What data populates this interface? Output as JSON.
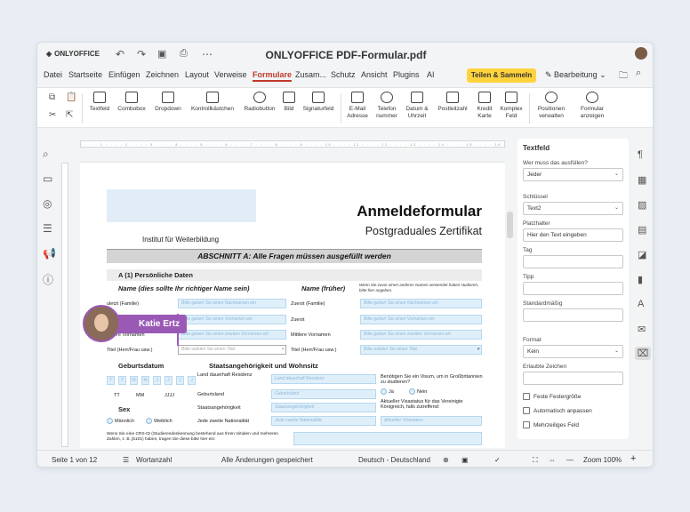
{
  "app": {
    "brand": "ONLYOFFICE",
    "doc_title": "ONLYOFFICE PDF-Formular.pdf"
  },
  "menu": [
    "Datei",
    "Startseite",
    "Einfügen",
    "Zeichnen",
    "Layout",
    "Verweise",
    "Formulare",
    "Zusam...",
    "Schutz",
    "Ansicht",
    "Plugins",
    "AI"
  ],
  "menu_active": "Formulare",
  "share_label": "Teilen & Sammeln",
  "edit_mode": "Bearbeitung",
  "toolbar": [
    {
      "label": "Textfeld",
      "icon": "textfield-icon"
    },
    {
      "label": "Combobox",
      "icon": "combobox-icon"
    },
    {
      "label": "Dropdown",
      "icon": "dropdown-icon"
    },
    {
      "label": "Kontrollkästchen",
      "icon": "checkbox-icon"
    },
    {
      "label": "Radiobutton",
      "icon": "radiobutton-icon"
    },
    {
      "label": "Bild",
      "icon": "image-icon"
    },
    {
      "label": "Signaturfeld",
      "icon": "signature-icon"
    },
    {
      "label": "E-Mail\nAdresse",
      "icon": "email-icon"
    },
    {
      "label": "Telefon\nnummer",
      "icon": "phone-icon"
    },
    {
      "label": "Datum &\nUhrzeit",
      "icon": "calendar-icon"
    },
    {
      "label": "Postleitzahl",
      "icon": "zip-icon"
    },
    {
      "label": "Kredit\nKarte",
      "icon": "creditcard-icon"
    },
    {
      "label": "Komplex\nFeld",
      "icon": "complex-icon"
    },
    {
      "label": "Positionen\nverwalten",
      "icon": "users-icon"
    },
    {
      "label": "Formular\nanzeigen",
      "icon": "eye-icon"
    }
  ],
  "page": {
    "title": "Anmeldeformular",
    "subtitle": "Postgraduales Zertifikat",
    "institute": "Institut für Weiterbildung",
    "section_a": "ABSCHNITT A: Alle Fragen müssen ausgefüllt werden",
    "personal": "A (1) Persönliche Daten",
    "name_hdr": "Name (dies sollte Ihr richtiger Name sein)",
    "name_prev_hdr": "Name (früher)",
    "name_prev_note": "Wenn Sie zuvor einen anderen Namen verwendet haben studieren, bitte hier angeben.",
    "row_first": "Zuerst (Familie)",
    "row_first2": "Zuerst",
    "row_middle": "Mittlere Vornamen",
    "row_middle_cut": "ere Vornamen",
    "row_first_cut": "uletzt (Familie)",
    "row_title": "Titel (Herr/Frau usw.)",
    "ph_lastname": "Bitte geben Sie einen Nachnamen ein",
    "ph_lastname2": "Bitte geben Sie einen Nachnamen ein",
    "ph_firstname": "Bitte geben Sie einen Vornamen ein",
    "ph_middle": "Bitte geben Sie einen zweiten Vornamen ein",
    "ph_title": "Bitte wählen Sie einen Titel",
    "ph_title2": "Bitte wählen Sie einen Titel",
    "dob_hdr": "Geburtsdatum",
    "nat_hdr": "Staatsangehörigkeit und Wohnsitz",
    "dob_tt": "TT",
    "dob_mm": "MM",
    "dob_jjjj": "JJJJ",
    "dob_box_t": "T",
    "dob_box_m": "M",
    "dob_box_j": "J",
    "residence_lab": "Land dauerhaft Residenz",
    "residence_ph": "Land dauerhaft Residenz",
    "birth_lab": "Geburtsland",
    "birth_ph": "Geburtsland",
    "nation_lab": "Staatsangehörigkeit",
    "nation_ph": "Staatsangehörigkeit",
    "second_nat_lab": "Jede zweite Nationalität",
    "second_nat_ph": "Jede zweite Nationalität",
    "visa_q": "Benötigen Sie ein Visum, um in Großbritannien zu studieren?",
    "yes": "Ja",
    "no": "Nein",
    "visa_status_q": "Aktueller Visastatus für das Vereinigte Königreich, falls zutreffend:",
    "visa_status_ph": "Aktueller Visastatus",
    "sex_hdr": "Sex",
    "male": "Männlich",
    "female": "Weiblich",
    "crs_note": "Wenn Sie eine CRS-ID (Studierendenkennung bestehend aus Ihren Initialen und mehreren Zahlen, z. B. jb101) haben, tragen Sie diese bitte hier ein:"
  },
  "collaborator": "Katie Ertz",
  "right_panel": {
    "title": "Textfeld",
    "who_label": "Wer muss das ausfüllen?",
    "who_value": "Jeder",
    "key_label": "Schlüssel",
    "key_value": "Text2",
    "placeholder_label": "Platzhalter",
    "placeholder_value": "Hier den Text eingeben",
    "tag_label": "Tag",
    "tip_label": "Tipp",
    "default_label": "Standardmäßig",
    "format_label": "Format",
    "format_value": "Kein",
    "allowed_label": "Erlaubte Zeichen",
    "fixed_size": "Feste Festergröße",
    "autofit": "Automatisch anpassen",
    "multiline": "Mehrzeiliges Feld"
  },
  "status": {
    "page": "Seite 1 von 12",
    "wordcount": "Wortanzahl",
    "saved": "Alle Änderungen gespeichert",
    "language": "Deutsch - Deutschland",
    "zoom": "Zoom 100%"
  }
}
